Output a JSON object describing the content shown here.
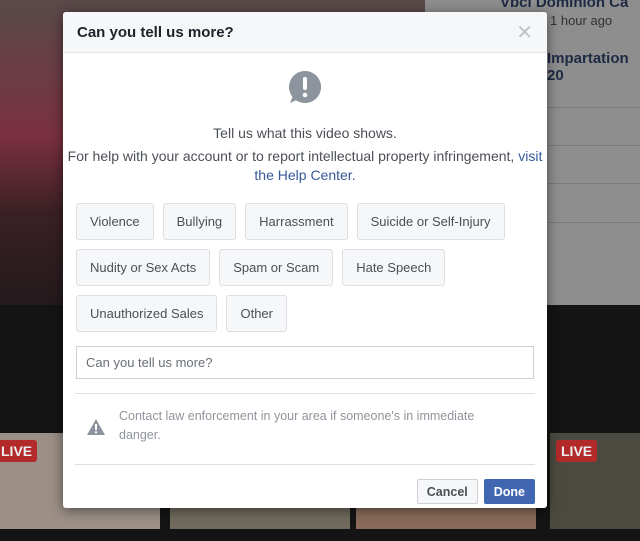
{
  "background": {
    "sidebar": {
      "title": "Vbci Dominion Ca",
      "time": "1 hour ago",
      "item": "Impartation 20"
    },
    "live_badge": "LIVE"
  },
  "modal": {
    "title": "Can you tell us more?",
    "close_icon": "close-icon",
    "alert_icon": "exclamation-speech-bubble-icon",
    "prompt": "Tell us what this video shows.",
    "help_text": "For help with your account or to report intellectual property infringement, ",
    "help_link": "visit the Help Center.",
    "options": [
      "Violence",
      "Bullying",
      "Harrassment",
      "Suicide or Self-Injury",
      "Nudity or Sex Acts",
      "Spam or Scam",
      "Hate Speech",
      "Unauthorized Sales",
      "Other"
    ],
    "input_placeholder": "Can you tell us more?",
    "warning_icon": "warning-triangle-icon",
    "warning": "Contact law enforcement in your area if someone's in immediate danger.",
    "cancel": "Cancel",
    "done": "Done",
    "accent": "#4267b2"
  }
}
